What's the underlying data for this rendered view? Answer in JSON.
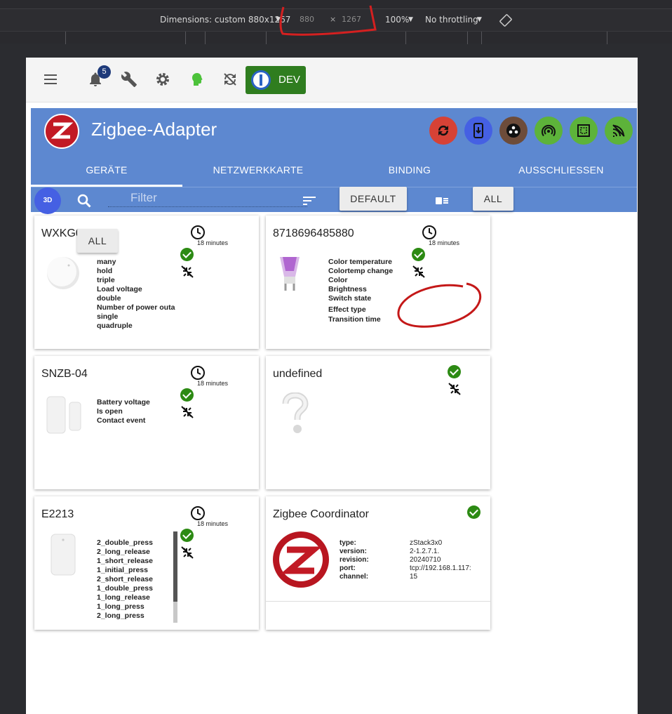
{
  "devtools": {
    "dimensions_label": "Dimensions: custom 880x1267",
    "width": "880",
    "height": "1267",
    "times": "×",
    "zoom": "100%",
    "throttle": "No throttling"
  },
  "toolbar": {
    "notification_count": "5",
    "dev_label": "DEV"
  },
  "header": {
    "title": "Zigbee-Adapter"
  },
  "tabs": [
    "GERÄTE",
    "NETZWERKKARTE",
    "BINDING",
    "AUSSCHLIESSEN"
  ],
  "filter": {
    "btn3d": "3D",
    "placeholder": "Filter",
    "default_label": "DEFAULT",
    "all_label": "ALL",
    "popup_all_label": "ALL"
  },
  "colors": {
    "accent": "#5d88d0",
    "ok": "#2c8a13",
    "dev": "#2f7d1f"
  },
  "devices": [
    {
      "name": "WXKG0",
      "time": "18 minutes",
      "states": [
        "many",
        "hold",
        "triple",
        "Load voltage",
        "double",
        "Number of power outa",
        "single",
        "quadruple"
      ]
    },
    {
      "name": "8718696485880",
      "time": "18 minutes",
      "states": [
        "Color temperature",
        "Colortemp change",
        "Color",
        "Brightness",
        "Switch state",
        "Effect type",
        "Transition time"
      ]
    },
    {
      "name": "SNZB-04",
      "time": "18 minutes",
      "states": [
        "Battery voltage",
        "Is open",
        "Contact event"
      ]
    },
    {
      "name": "undefined"
    },
    {
      "name": "E2213",
      "time": "18 minutes",
      "states": [
        "2_double_press",
        "2_long_release",
        "1_short_release",
        "1_initial_press",
        "2_short_release",
        "1_double_press",
        "1_long_release",
        "1_long_press",
        "2_long_press"
      ]
    },
    {
      "name": "Zigbee Coordinator",
      "info": [
        [
          "type:",
          "zStack3x0"
        ],
        [
          "version:",
          "2-1.2.7.1."
        ],
        [
          "revision:",
          "20240710"
        ],
        [
          "port:",
          "tcp://192.168.1.117:"
        ],
        [
          "channel:",
          "15"
        ]
      ]
    }
  ]
}
